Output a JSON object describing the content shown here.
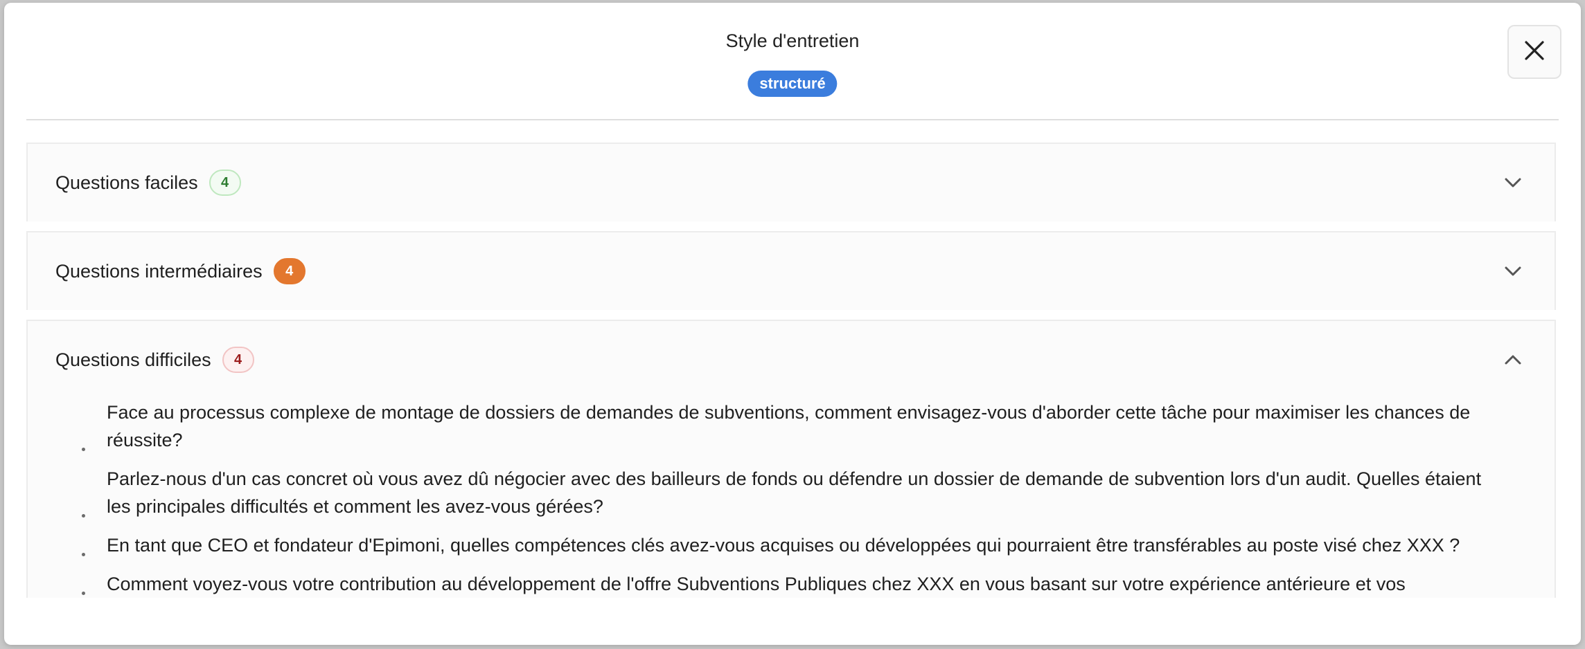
{
  "dialog": {
    "title": "Style d'entretien",
    "style_badge": "structuré"
  },
  "sections": [
    {
      "title": "Questions faciles",
      "count": "4",
      "expanded": false,
      "icon": "chevron-down-icon"
    },
    {
      "title": "Questions intermédiaires",
      "count": "4",
      "expanded": false,
      "icon": "chevron-down-icon"
    },
    {
      "title": "Questions difficiles",
      "count": "4",
      "expanded": true,
      "icon": "chevron-up-icon",
      "questions": [
        "Face au processus complexe de montage de dossiers de demandes de subventions, comment envisagez-vous d'aborder cette tâche pour maximiser les chances de réussite?",
        "Parlez-nous d'un cas concret où vous avez dû négocier avec des bailleurs de fonds ou défendre un dossier de demande de subvention lors d'un audit. Quelles étaient les principales difficultés et comment les avez-vous gérées?",
        "En tant que CEO et fondateur d'Epimoni, quelles compétences clés avez-vous acquises ou développées qui pourraient être transférables au poste visé chez XXX ?",
        "Comment voyez-vous votre contribution au développement de l'offre Subventions Publiques chez XXX en vous basant sur votre expérience antérieure et vos"
      ]
    }
  ],
  "colors": {
    "style_badge": "#3b7ddd",
    "easy": "#2e7d32",
    "intermediate": "#e3772e",
    "hard": "#9b1c1c"
  },
  "icons": {
    "close": "close-icon"
  }
}
